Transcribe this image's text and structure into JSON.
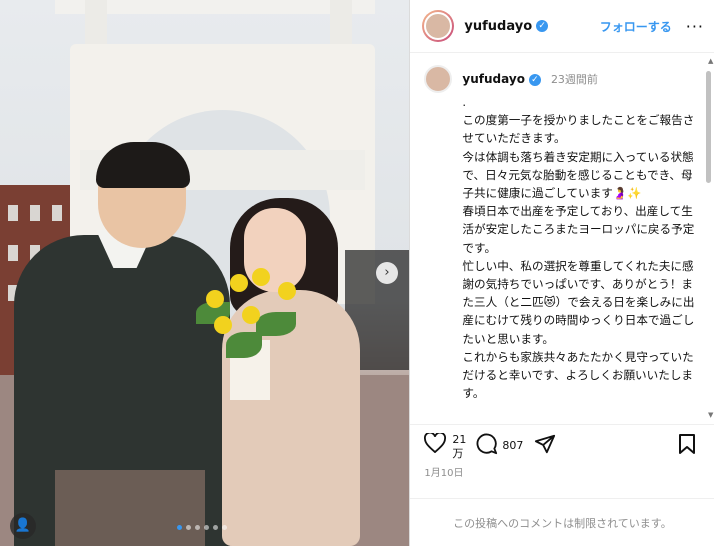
{
  "post": {
    "username": "yufudayo",
    "follow_label": "フォローする",
    "more_label": "···",
    "time_ago": "23週間前",
    "caption": ".\nこの度第一子を授かりましたことをご報告させていただきます。\n今は体調も落ち着き安定期に入っている状態で、日々元気な胎動を感じることもでき、母子共に健康に過ごしています🤰✨\n春頃日本で出産を予定しており、出産して生活が安定したころまたヨーロッパに戻る予定です。\n忙しい中、私の選択を尊重してくれた夫に感謝の気持ちでいっぱいです、ありがとう！また三人（と二匹😻）で会える日を楽しみに出産にむけて残りの時間ゆっくり日本で過ごしたいと思います。\nこれからも家族共々あたたかく見守っていただけると幸いです、よろしくお願いいたします。\n\n中布菜月",
    "likes": "21\n万",
    "comments": "807",
    "date": "1月10日",
    "comments_disabled": "この投稿へのコメントは制限されています。"
  },
  "carousel": {
    "count": 6,
    "active": 0
  },
  "icons": {
    "next": "chevron-right-icon",
    "user_tag": "user-tag-icon",
    "like": "heart-icon",
    "comment": "comment-icon",
    "share": "send-icon",
    "save": "bookmark-icon",
    "verified": "verified-badge-icon"
  },
  "colors": {
    "accent": "#3897f0",
    "muted": "#8e8e8e"
  }
}
